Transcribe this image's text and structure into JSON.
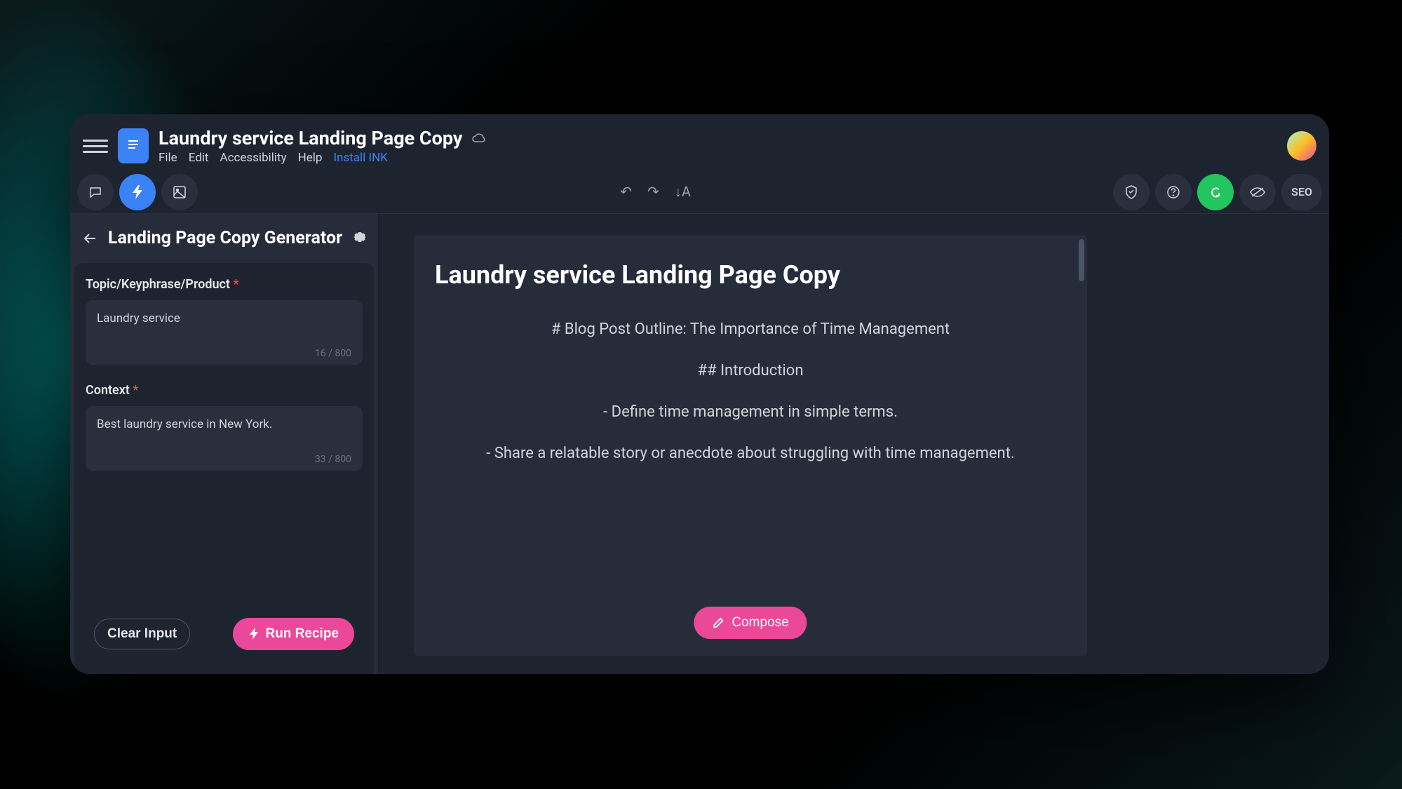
{
  "header": {
    "doc_title": "Laundry service Landing Page Copy",
    "menu": {
      "file": "File",
      "edit": "Edit",
      "accessibility": "Accessibility",
      "help": "Help",
      "install": "Install INK"
    }
  },
  "toolbar": {
    "seo_label": "SEO"
  },
  "sidebar": {
    "title": "Landing Page Copy Generator",
    "field1": {
      "label": "Topic/Keyphrase/Product",
      "value": "Laundry service",
      "count": "16 / 800"
    },
    "field2": {
      "label": "Context",
      "value": "Best laundry service in New York.",
      "count": "33 / 800"
    },
    "clear_label": "Clear Input",
    "run_label": "Run Recipe"
  },
  "editor": {
    "heading": "Laundry service Landing Page Copy",
    "p1": "# Blog Post Outline: The Importance of Time Management",
    "p2": "## Introduction",
    "p3": "- Define time management in simple terms.",
    "p4": "- Share a relatable story or anecdote about struggling with time management.",
    "compose_label": "Compose"
  }
}
